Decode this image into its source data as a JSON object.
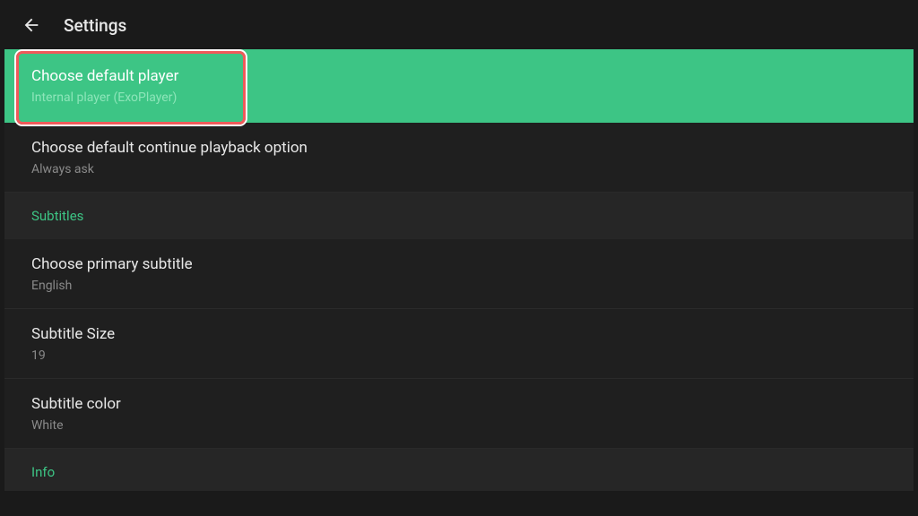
{
  "header": {
    "title": "Settings"
  },
  "items": {
    "defaultPlayer": {
      "title": "Choose default player",
      "subtitle": "Internal player (ExoPlayer)"
    },
    "continuePlayback": {
      "title": "Choose default continue playback option",
      "subtitle": "Always ask"
    },
    "primarySubtitle": {
      "title": "Choose primary subtitle",
      "subtitle": "English"
    },
    "subtitleSize": {
      "title": "Subtitle Size",
      "subtitle": "19"
    },
    "subtitleColor": {
      "title": "Subtitle color",
      "subtitle": "White"
    }
  },
  "sections": {
    "subtitles": "Subtitles",
    "info": "Info"
  }
}
